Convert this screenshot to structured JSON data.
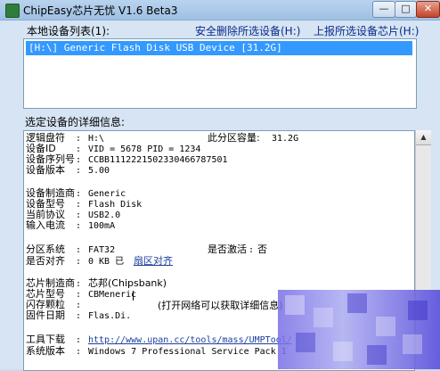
{
  "window": {
    "title": "ChipEasy芯片无忧 V1.6 Beta3",
    "min_label": "—",
    "max_label": "□",
    "close_label": "✕"
  },
  "header": {
    "device_list_label": "本地设备列表(1):",
    "safe_remove_link": "安全删除所选设备(H:)",
    "report_chip_link": "上报所选设备芯片(H:)"
  },
  "device_list": {
    "items": [
      "[H:\\] Generic Flash Disk USB Device [31.2G]"
    ]
  },
  "details": {
    "label": "选定设备的详细信息:",
    "rows": {
      "drive_letter": {
        "label": "逻辑盘符",
        "value": "H:\\"
      },
      "partition_capacity": {
        "label": "此分区容量:",
        "value": "31.2G"
      },
      "device_id": {
        "label": "设备ID",
        "value": "VID = 5678      PID = 1234"
      },
      "serial": {
        "label": "设备序列号",
        "value": "CCBB1112221502330466787501"
      },
      "version": {
        "label": "设备版本",
        "value": "5.00"
      },
      "manufacturer": {
        "label": "设备制造商",
        "value": "Generic"
      },
      "model": {
        "label": "设备型号",
        "value": "Flash Disk"
      },
      "protocol": {
        "label": "当前协议",
        "value": "USB2.0"
      },
      "current": {
        "label": "输入电流",
        "value": "100mA"
      },
      "filesystem": {
        "label": "分区系统",
        "value": "FAT32"
      },
      "activated": {
        "label": "是否激活",
        "value": "否"
      },
      "aligned": {
        "label": "是否对齐",
        "value": "0 KB 已",
        "link": "扇区对齐"
      },
      "chip_vendor": {
        "label": "芯片制造商",
        "value": "芯邦(Chipsbank)"
      },
      "chip_model": {
        "label": "芯片型号",
        "value": "CBMeneric"
      },
      "flash": {
        "label": "闪存颗粒",
        "value": ""
      },
      "note": "(打开网络可以获取详细信息)",
      "firmware_date": {
        "label": "固件日期",
        "value": "Flas.Di."
      },
      "tool_download": {
        "label": "工具下载",
        "value": "http://www.upan.cc/tools/mass/UMPTool/"
      },
      "system_version": {
        "label": "系统版本",
        "value": "Windows 7 Professional Service Pack 1"
      }
    },
    "colon": ":"
  },
  "colors": {
    "selection": "#3399ff",
    "link": "#0a2a8a",
    "frame": "#d6e4f3"
  }
}
